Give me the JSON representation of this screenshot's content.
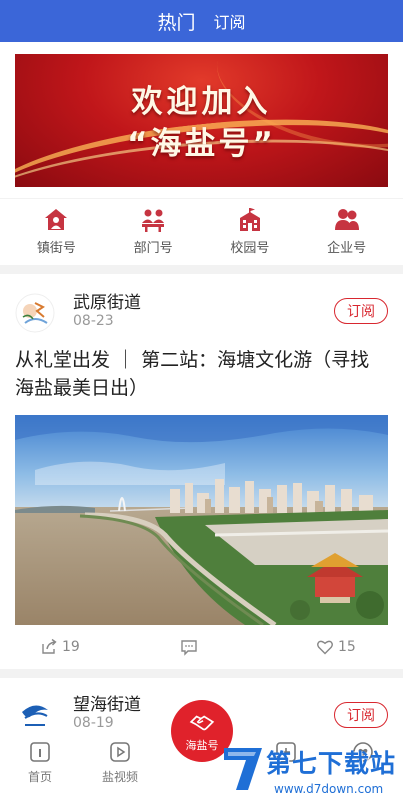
{
  "header": {
    "tabs": [
      {
        "label": "热门"
      },
      {
        "label": "订阅"
      }
    ]
  },
  "banner": {
    "line1": "欢迎加入",
    "line2": "“海盐号”"
  },
  "categories": [
    {
      "label": "镇街号",
      "icon": "house-person-icon"
    },
    {
      "label": "部门号",
      "icon": "department-people-icon"
    },
    {
      "label": "校园号",
      "icon": "school-building-icon"
    },
    {
      "label": "企业号",
      "icon": "enterprise-people-icon"
    }
  ],
  "feed": [
    {
      "author": "武原街道",
      "date": "08-23",
      "subscribe_label": "订阅",
      "title": "从礼堂出发 ｜ 第二站：海塘文化游（寻找海盐最美日出）",
      "shares": "19",
      "likes": "15"
    },
    {
      "author": "望海街道",
      "date": "08-19",
      "subscribe_label": "订阅"
    }
  ],
  "bottom_nav": {
    "items": [
      {
        "label": "首页",
        "icon": "home-icon"
      },
      {
        "label": "盐视频",
        "icon": "play-icon"
      },
      {
        "label": "海盐号",
        "icon": "handshake-icon"
      },
      {
        "label": "",
        "icon": "add-icon"
      },
      {
        "label": "",
        "icon": "heart-icon"
      }
    ]
  },
  "watermark": {
    "brand": "第七下载站",
    "url": "www.d7down.com"
  },
  "colors": {
    "header_blue": "#3b66d8",
    "accent_red": "#d8272f",
    "icon_red": "#c63441"
  }
}
